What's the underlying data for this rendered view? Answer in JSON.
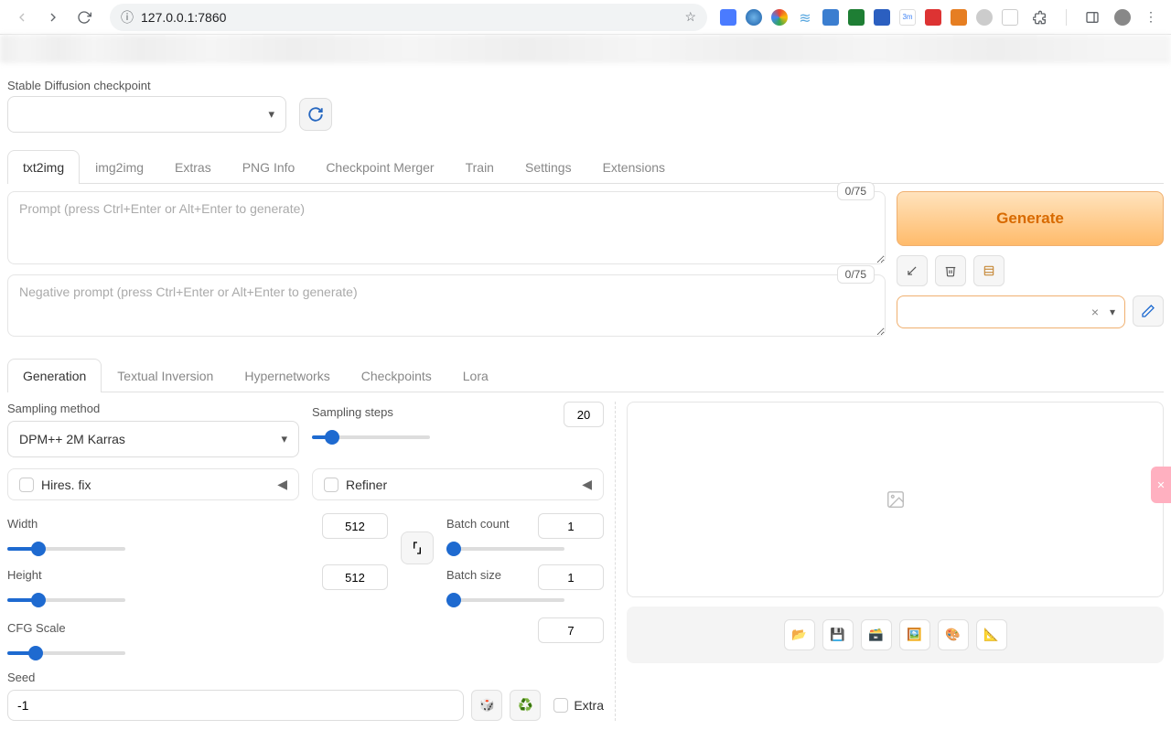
{
  "browser": {
    "url": "127.0.0.1:7860"
  },
  "checkpoint": {
    "label": "Stable Diffusion checkpoint",
    "value": ""
  },
  "mainTabs": [
    "txt2img",
    "img2img",
    "Extras",
    "PNG Info",
    "Checkpoint Merger",
    "Train",
    "Settings",
    "Extensions"
  ],
  "prompt": {
    "placeholder": "Prompt (press Ctrl+Enter or Alt+Enter to generate)",
    "tokens": "0/75"
  },
  "negPrompt": {
    "placeholder": "Negative prompt (press Ctrl+Enter or Alt+Enter to generate)",
    "tokens": "0/75"
  },
  "generateLabel": "Generate",
  "subTabs": [
    "Generation",
    "Textual Inversion",
    "Hypernetworks",
    "Checkpoints",
    "Lora"
  ],
  "sampling": {
    "methodLabel": "Sampling method",
    "methodValue": "DPM++ 2M Karras",
    "stepsLabel": "Sampling steps",
    "stepsValue": "20"
  },
  "hiresLabel": "Hires. fix",
  "refinerLabel": "Refiner",
  "width": {
    "label": "Width",
    "value": "512"
  },
  "height": {
    "label": "Height",
    "value": "512"
  },
  "batchCount": {
    "label": "Batch count",
    "value": "1"
  },
  "batchSize": {
    "label": "Batch size",
    "value": "1"
  },
  "cfg": {
    "label": "CFG Scale",
    "value": "7"
  },
  "seed": {
    "label": "Seed",
    "value": "-1"
  },
  "extraLabel": "Extra"
}
